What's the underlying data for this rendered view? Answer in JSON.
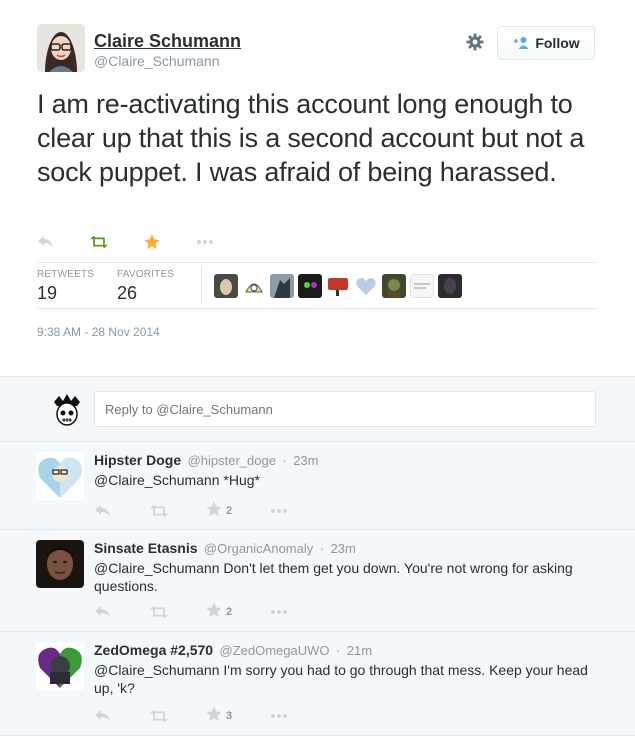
{
  "tweet": {
    "name": "Claire Schumann",
    "handle": "@Claire_Schumann",
    "follow_label": "Follow",
    "text": "I am re-activating this account long enough to clear up that this is a second account but not a sock puppet. I was afraid of being harassed.",
    "retweets_label": "RETWEETS",
    "retweets_count": "19",
    "favorites_label": "FAVORITES",
    "favorites_count": "26",
    "timestamp": "9:38 AM - 28 Nov 2014",
    "favorite_color": "#ffac33",
    "retweet_color": "#609928"
  },
  "reply_box": {
    "placeholder": "Reply to @Claire_Schumann"
  },
  "replies": [
    {
      "name": "Hipster Doge",
      "handle": "@hipster_doge",
      "time": "23m",
      "text": "@Claire_Schumann *Hug*",
      "favorites": "2"
    },
    {
      "name": "Sinsate Etasnis",
      "handle": "@OrganicAnomaly",
      "time": "23m",
      "text": "@Claire_Schumann Don't let them get you down. You're not wrong for asking questions.",
      "favorites": "2"
    },
    {
      "name": "ZedOmega #2,570",
      "handle": "@ZedOmegaUWO",
      "time": "21m",
      "text": "@Claire_Schumann I'm sorry you had to go through that mess. Keep your head up, 'k?",
      "favorites": "3"
    }
  ],
  "separator": "·",
  "icons": [
    "reply-icon",
    "retweet-icon",
    "favorite-icon",
    "more-icon",
    "gear-icon",
    "follow-person-icon"
  ]
}
